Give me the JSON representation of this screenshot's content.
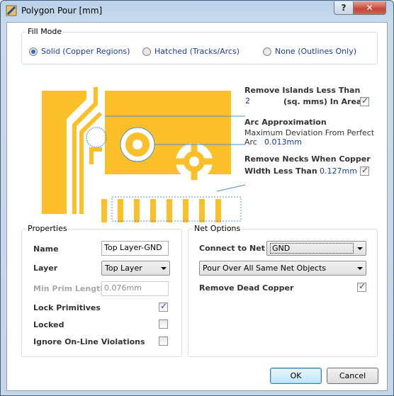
{
  "window": {
    "title": "Polygon Pour [mm]",
    "help_label": "?",
    "close_label": "✕"
  },
  "fill_mode": {
    "title": "Fill Mode",
    "options": [
      {
        "label": "Solid (Copper Regions)",
        "selected": true
      },
      {
        "label": "Hatched (Tracks/Arcs)",
        "selected": false
      },
      {
        "label": "None (Outlines Only)",
        "selected": false
      }
    ]
  },
  "diagram": {
    "remove_islands": {
      "label_line1": "Remove Islands Less Than",
      "value": "2",
      "label_line2": "(sq. mms) In Area",
      "checked": true
    },
    "arc_approx": {
      "label": "Arc Approximation",
      "desc_line1": "Maximum Deviation From Perfect",
      "desc_line2": "Arc",
      "value": "0.013mm"
    },
    "remove_necks": {
      "label_line1": "Remove Necks When Copper",
      "label_line2": "Width Less Than",
      "value": "0.127mm",
      "checked": true
    },
    "colors": {
      "copper": "#fbbf2a",
      "outline": "#4f8cd0"
    }
  },
  "properties": {
    "title": "Properties",
    "name_label": "Name",
    "name_value": "Top Layer-GND",
    "layer_label": "Layer",
    "layer_value": "Top Layer",
    "min_prim_label": "Min Prim Length",
    "min_prim_value": "0.076mm",
    "lock_primitives_label": "Lock Primitives",
    "lock_primitives_checked": true,
    "locked_label": "Locked",
    "locked_checked": false,
    "ignore_label": "Ignore On-Line Violations",
    "ignore_checked": false
  },
  "net_options": {
    "title": "Net Options",
    "connect_label": "Connect to Net",
    "connect_value": "GND",
    "pour_over_value": "Pour Over All Same Net Objects",
    "remove_dead_label": "Remove Dead Copper",
    "remove_dead_checked": true
  },
  "buttons": {
    "ok": "OK",
    "cancel": "Cancel"
  }
}
